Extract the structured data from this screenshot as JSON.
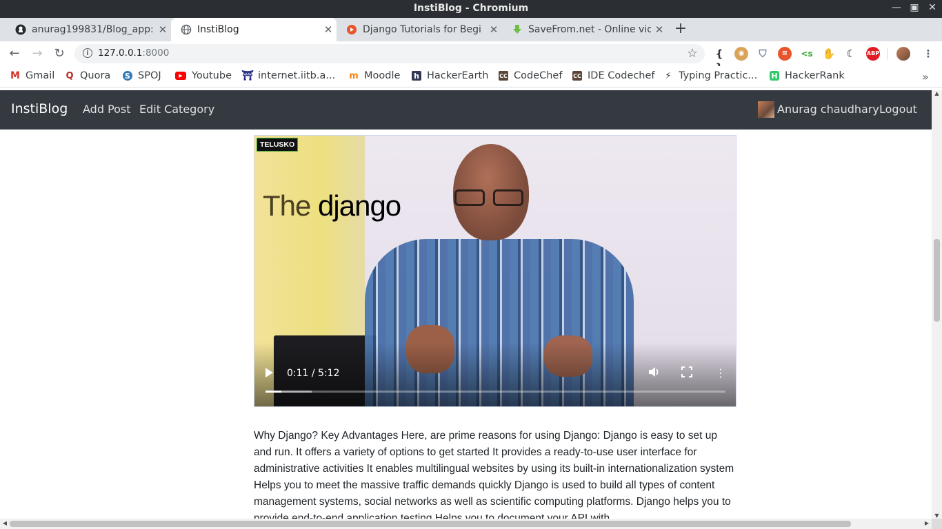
{
  "window": {
    "title": "InstiBlog - Chromium"
  },
  "tabs": [
    {
      "label": "anurag199831/Blog_app:",
      "icon": "github-icon"
    },
    {
      "label": "InstiBlog",
      "icon": "globe-icon",
      "active": true
    },
    {
      "label": "Django Tutorials for Begi",
      "icon": "youtube-icon"
    },
    {
      "label": "SaveFrom.net - Online vid",
      "icon": "savefrom-icon"
    }
  ],
  "address": {
    "host": "127.0.0.1",
    "port": ":8000"
  },
  "bookmarks": [
    {
      "label": "Gmail",
      "icon": "gmail-icon",
      "color": "#d93025"
    },
    {
      "label": "Quora",
      "icon": "quora-icon",
      "color": "#b92b27"
    },
    {
      "label": "SPOJ",
      "icon": "spoj-icon",
      "color": "#337ab7"
    },
    {
      "label": "Youtube",
      "icon": "youtube-icon",
      "color": "#ff0000"
    },
    {
      "label": "internet.iitb.a...",
      "icon": "iitb-icon",
      "color": "#1a237e"
    },
    {
      "label": "Moodle",
      "icon": "moodle-icon",
      "color": "#f98012"
    },
    {
      "label": "HackerEarth",
      "icon": "hackerearth-icon",
      "color": "#323754"
    },
    {
      "label": "CodeChef",
      "icon": "codechef-icon",
      "color": "#5b4638"
    },
    {
      "label": "IDE Codechef",
      "icon": "codechef-icon",
      "color": "#5b4638"
    },
    {
      "label": "Typing Practic...",
      "icon": "lightning-icon",
      "color": "#333333"
    },
    {
      "label": "HackerRank",
      "icon": "hackerrank-icon",
      "color": "#2ec866"
    }
  ],
  "navbar": {
    "brand": "InstiBlog",
    "add_post": "Add Post",
    "edit_category": "Edit Category",
    "user": "Anurag chaudhary",
    "logout": "Logout"
  },
  "video": {
    "channel_logo": "TELUSKO",
    "title_prefix": "The",
    "title_main": "django",
    "current_time": "0:11",
    "duration": "5:12",
    "time_display": "0:11 / 5:12",
    "played_fraction": 0.035,
    "buffered_fraction": 0.1
  },
  "post": {
    "body": "Why Django? Key Advantages Here, are prime reasons for using Django: Django is easy to set up and run. It offers a variety of options to get started It provides a ready-to-use user interface for administrative activities It enables multilingual websites by using its built-in internationalization system Helps you to meet the massive traffic demands quickly Django is used to build all types of content management systems, social networks as well as scientific computing platforms. Django helps you to provide end-to-end application testing Helps you to document your API with"
  }
}
